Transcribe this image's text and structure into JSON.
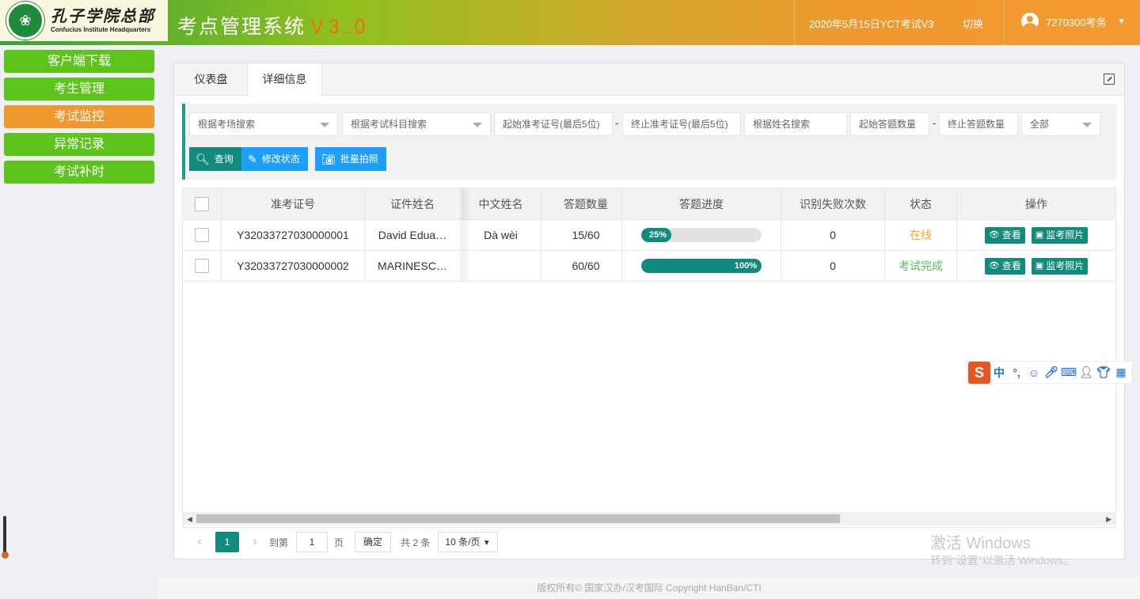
{
  "header": {
    "logo_cn": "孔子学院总部",
    "logo_en": "Confucius Institute Headquarters",
    "app_title": "考点管理系统",
    "app_version": "V3.0",
    "exam_name": "2020年5月15日YCT考试V3",
    "switch_label": "切换",
    "user_name": "7270300考务"
  },
  "sidebar": {
    "items": [
      {
        "label": "客户端下载"
      },
      {
        "label": "考生管理"
      },
      {
        "label": "考试监控"
      },
      {
        "label": "异常记录"
      },
      {
        "label": "考试补时"
      }
    ],
    "active_index": 2
  },
  "tabs": [
    {
      "label": "仪表盘"
    },
    {
      "label": "详细信息"
    }
  ],
  "filters": {
    "exam_room": "根据考场搜索",
    "subject": "根据考试科目搜索",
    "start_id": "起始准考证号(最后5位)",
    "end_id": "终止准考证号(最后5位)",
    "name": "根据姓名搜索",
    "start_count": "起始答题数量",
    "end_count": "终止答题数量",
    "status": "全部",
    "range_sep": "-"
  },
  "actions": {
    "query": "查询",
    "modify_status": "修改状态",
    "batch_photo": "批量拍照"
  },
  "table": {
    "columns": [
      "准考证号",
      "证件姓名",
      "中文姓名",
      "答题数量",
      "答题进度",
      "识别失败次数",
      "状态",
      "操作"
    ],
    "rows": [
      {
        "id": "Y32033727030000001",
        "name": "David Edua…",
        "cn_name": "Dà wèi",
        "count": "15/60",
        "progress_label": "25%",
        "progress": 25,
        "fail": "0",
        "status": "在线",
        "status_type": "online"
      },
      {
        "id": "Y32033727030000002",
        "name": "MARINESC…",
        "cn_name": "",
        "count": "60/60",
        "progress_label": "100%",
        "progress": 100,
        "fail": "0",
        "status": "考试完成",
        "status_type": "done"
      }
    ],
    "op_view": "查看",
    "op_photo": "监考照片"
  },
  "pager": {
    "current": "1",
    "goto_label": "到第",
    "page_input": "1",
    "page_unit": "页",
    "ok": "确定",
    "total": "共 2 条",
    "page_size": "10 条/页"
  },
  "ime": {
    "mode": "中",
    "punct": "°,"
  },
  "watermark": {
    "line1": "激活 Windows",
    "line2": "转到“设置”以激活 Windows。"
  },
  "footer": "版权所有© 国家汉办/汉考国际 Copyright HanBan/CTI",
  "colors": {
    "teal": "#128a7c",
    "orange": "#f0982e",
    "green": "#5cc41a",
    "blue": "#1e9fff"
  }
}
